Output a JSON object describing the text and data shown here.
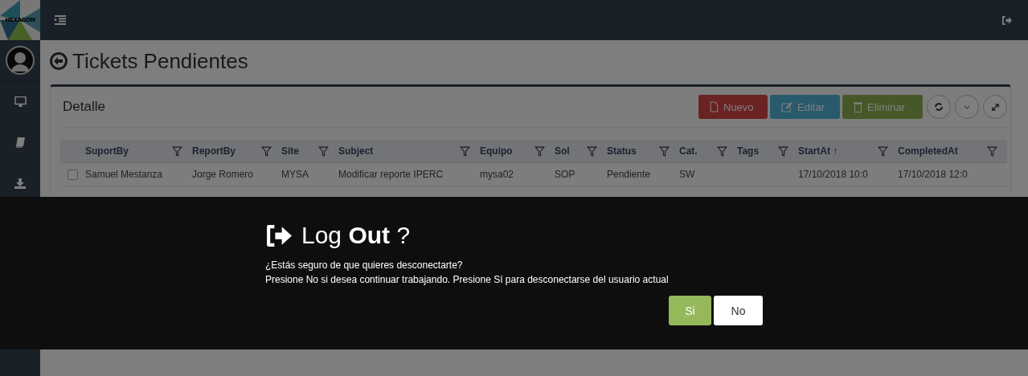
{
  "logo": {
    "text": "HEXAGON"
  },
  "page": {
    "title": "Tickets Pendientes"
  },
  "panel": {
    "title": "Detalle",
    "buttons": [
      {
        "label": "Nuevo",
        "kind": "new"
      },
      {
        "label": "Editar",
        "kind": "edit"
      },
      {
        "label": "Eliminar",
        "kind": "delete"
      }
    ],
    "tools": [
      {
        "kind": "refresh"
      },
      {
        "kind": "collapse"
      },
      {
        "kind": "expand"
      }
    ]
  },
  "table": {
    "columns": [
      {
        "label": "SuportBy"
      },
      {
        "label": "ReportBy"
      },
      {
        "label": "Site"
      },
      {
        "label": "Subject"
      },
      {
        "label": "Equipo"
      },
      {
        "label": "Sol"
      },
      {
        "label": "Status"
      },
      {
        "label": "Cat."
      },
      {
        "label": "Tags"
      },
      {
        "label": "StartAt ↑"
      },
      {
        "label": "CompletedAt"
      }
    ],
    "rows": [
      {
        "checked": false,
        "cells": [
          "Samuel Mestanza",
          "Jorge Romero",
          "MYSA",
          "Modificar reporte IPERC",
          "mysa02",
          "SOP",
          "Pendiente",
          "SW",
          "",
          "17/10/2018 10:0",
          "17/10/2018 12:0"
        ]
      }
    ]
  },
  "dialog": {
    "title": "Log **Out** ?",
    "lines": [
      "¿Estás seguro de que quieres desconectarte?",
      "Presione No si desea continuar trabajando. Presione Sí para desconectarse del usuario actual"
    ],
    "buttons": [
      {
        "label": "Si",
        "kind": "confirm"
      },
      {
        "label": "No",
        "kind": "cancel"
      }
    ]
  }
}
